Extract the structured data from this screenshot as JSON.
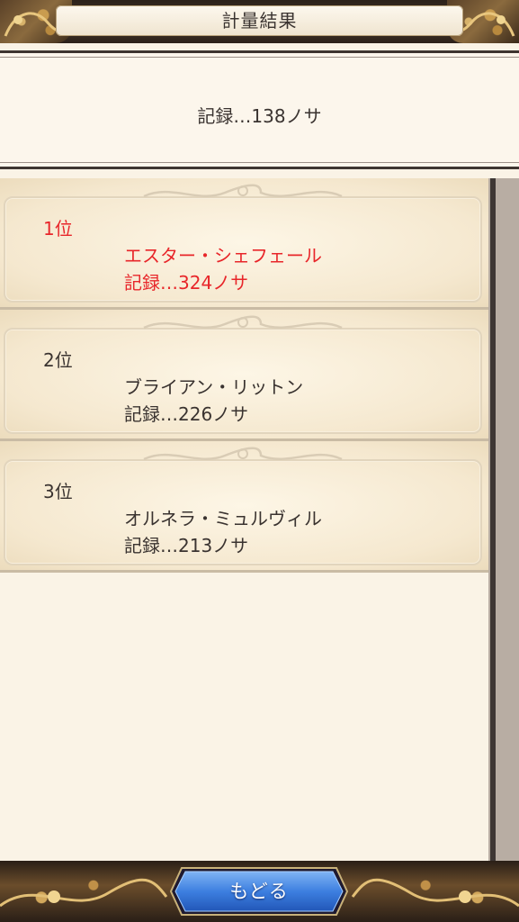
{
  "header": {
    "title": "計量結果"
  },
  "current_record": {
    "text": "記録…138ノサ"
  },
  "rankings": [
    {
      "rank": "1位",
      "name": "エスター・シェフェール",
      "record": "記録…324ノサ",
      "highlight": true
    },
    {
      "rank": "2位",
      "name": "ブライアン・リットン",
      "record": "記録…226ノサ",
      "highlight": false
    },
    {
      "rank": "3位",
      "name": "オルネラ・ミュルヴィル",
      "record": "記録…213ノサ",
      "highlight": false
    }
  ],
  "footer": {
    "back_label": "もどる"
  },
  "colors": {
    "highlight": "#e8262a",
    "text": "#3a3330",
    "panel_bg": "#faf3e6",
    "button_blue": "#3d7fe0"
  }
}
